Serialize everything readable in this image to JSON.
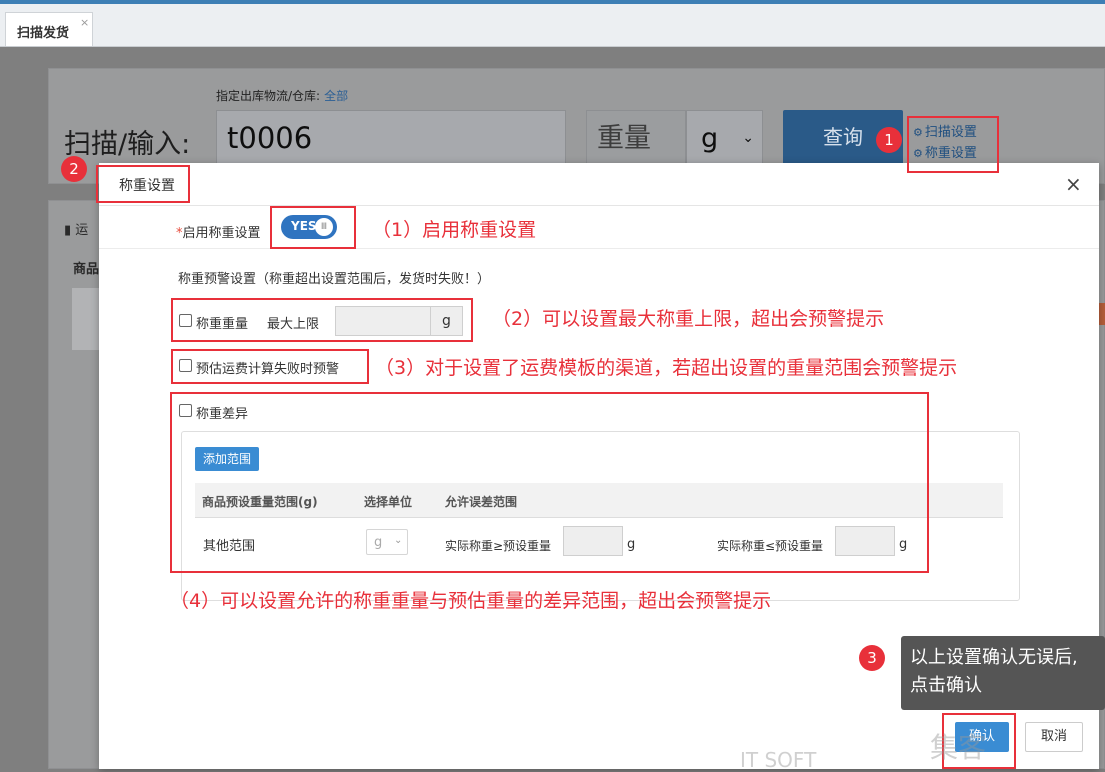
{
  "tab": {
    "label": "扫描发货",
    "close": "×"
  },
  "scan_panel": {
    "warehouse_label": "指定出库物流/仓库:",
    "warehouse_value": "全部",
    "scan_label": "扫描/输入:",
    "scan_value": "t0006",
    "weight_label": "重量",
    "unit_value": "g",
    "query_button": "查询",
    "scan_settings_link": "扫描设置",
    "weigh_settings_link": "称重设置"
  },
  "background_fragments": {
    "waybill": "运",
    "goods": "商品"
  },
  "modal": {
    "title": "称重设置",
    "close": "×",
    "enable_label": "*启用称重设置",
    "toggle_text": "YES",
    "warning_label": "称重预警设置（称重超出设置范围后，发货时失败！）",
    "max_weight_label": "称重重量",
    "max_limit_label": "最大上限",
    "max_unit": "g",
    "freight_label": "预估运费计算失败时预警",
    "diff_label": "称重差异",
    "add_range_button": "添加范围",
    "table_headers": [
      "商品预设重量范围(g)",
      "选择单位",
      "允许误差范围"
    ],
    "row": {
      "range": "其他范围",
      "unit": "g",
      "ge_label": "实际称重≥预设重量",
      "ge_unit": "g",
      "le_label": "实际称重≤预设重量",
      "le_unit": "g"
    },
    "ok_button": "确认",
    "cancel_button": "取消"
  },
  "annotations": {
    "a1": "（1）启用称重设置",
    "a2": "（2）可以设置最大称重上限，超出会预警提示",
    "a3": "（3）对于设置了运费模板的渠道，若超出设置的重量范围会预警提示",
    "a4": "（4）可以设置允许的称重重量与预估重量的差异范围，超出会预警提示"
  },
  "badges": {
    "b1": "1",
    "b2": "2",
    "b3": "3"
  },
  "tooltip": {
    "line1": "以上设置确认无误后,",
    "line2": "点击确认"
  },
  "watermark": "集客",
  "watermark2": "IT SOFT"
}
